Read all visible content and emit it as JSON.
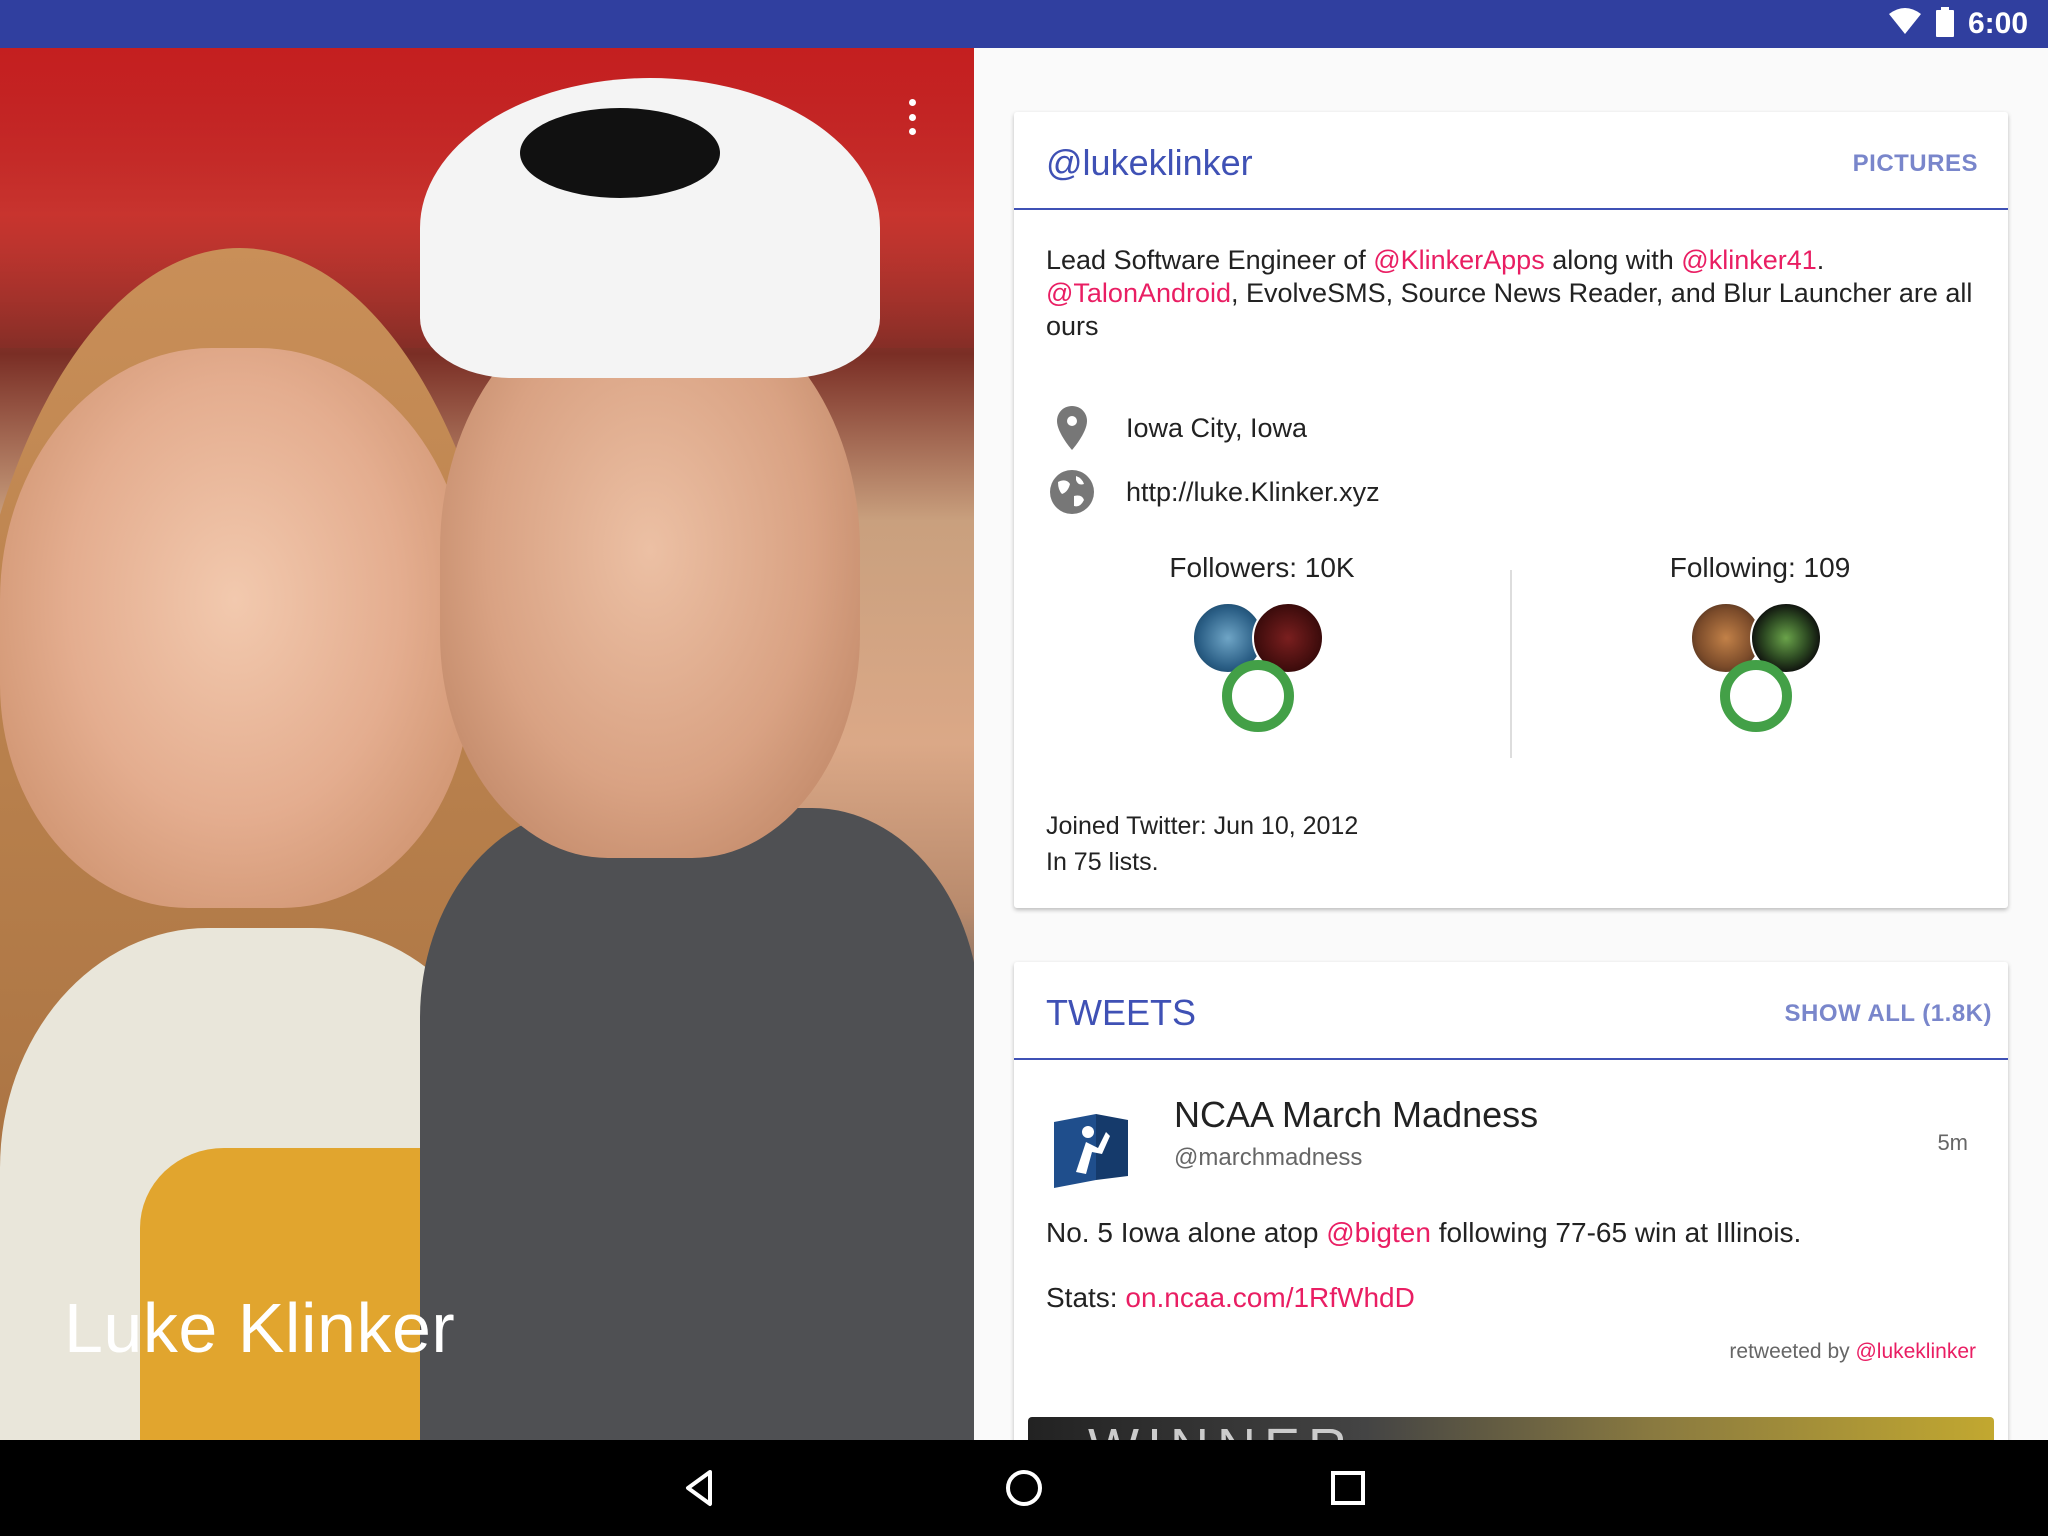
{
  "status_bar": {
    "time": "6:00"
  },
  "profile": {
    "name": "Luke Klinker",
    "handle": "@lukeklinker",
    "pictures_label": "PICTURES",
    "bio_parts": [
      "Lead Software Engineer of ",
      "@KlinkerApps",
      " along with ",
      "@klinker41",
      ". ",
      "@TalonAndroid",
      ", EvolveSMS, Source News Reader, and Blur Launcher are all ours"
    ],
    "location": "Iowa City, Iowa",
    "website": "http://luke.Klinker.xyz",
    "followers_label": "Followers: 10K",
    "following_label": "Following: 109",
    "joined": "Joined Twitter: Jun 10, 2012",
    "lists": "In 75 lists."
  },
  "tweets_section": {
    "title": "TWEETS",
    "show_all": "SHOW ALL (1.8K)",
    "tweet": {
      "author_name": "NCAA March Madness",
      "author_handle": "@marchmadness",
      "time": "5m",
      "text_before": "No. 5 Iowa alone atop ",
      "text_mention": "@bigten",
      "text_after": " following 77-65 win at Illinois.",
      "stats_label": "Stats: ",
      "stats_link": "on.ncaa.com/1RfWhdD",
      "retweeted_prefix": "retweeted by ",
      "retweeted_user": "@lukeklinker",
      "media_text": "WINNER"
    }
  },
  "icons": {
    "wifi": "wifi-icon",
    "battery": "battery-icon",
    "location": "location-pin-icon",
    "website": "globe-icon",
    "overflow": "more-vert-icon",
    "back": "back-icon",
    "home": "home-icon",
    "recents": "recents-icon"
  },
  "colors": {
    "status_bar": "#303F9F",
    "primary": "#3F51B5",
    "accent": "#E91E63",
    "header_action": "#7986CB"
  }
}
